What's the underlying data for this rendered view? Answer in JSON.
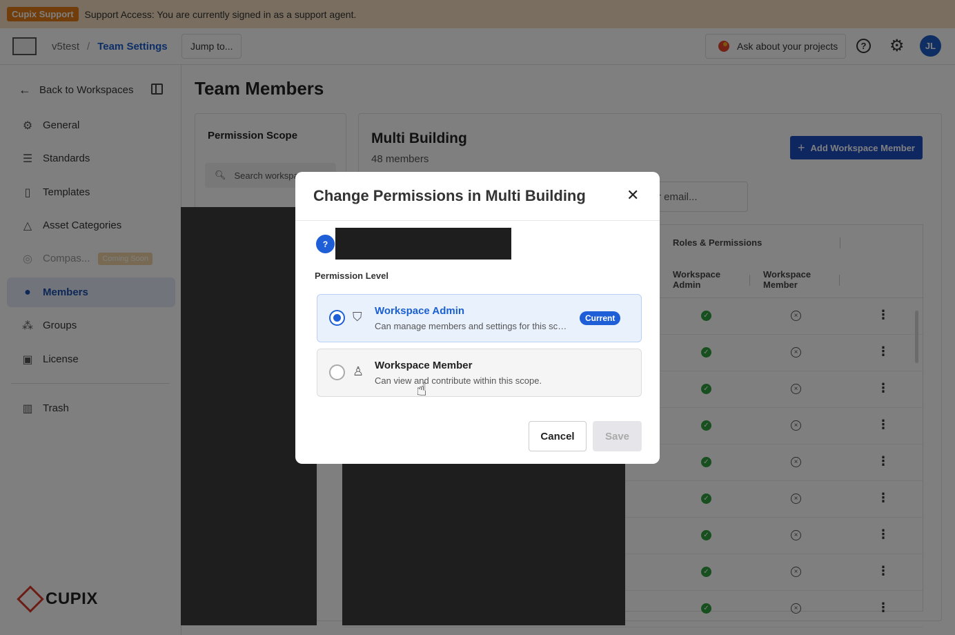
{
  "banner": {
    "badge": "Cupix Support",
    "message": "Support Access: You are currently signed in as a support agent."
  },
  "topbar": {
    "workspace": "v5test",
    "separator": "/",
    "current": "Team Settings",
    "jump_label": "Jump to...",
    "ask_label": "Ask about your projects",
    "help_glyph": "?",
    "avatar_initials": "JL"
  },
  "sidebar": {
    "back_label": "Back to Workspaces",
    "items": [
      {
        "label": "General",
        "icon": "gear-icon"
      },
      {
        "label": "Standards",
        "icon": "sliders-icon"
      },
      {
        "label": "Templates",
        "icon": "document-icon"
      },
      {
        "label": "Asset Categories",
        "icon": "shapes-icon"
      },
      {
        "label": "Compas...",
        "icon": "compass-icon",
        "badge": "Coming Soon"
      },
      {
        "label": "Members",
        "icon": "person-icon",
        "active": true
      },
      {
        "label": "Groups",
        "icon": "group-icon"
      },
      {
        "label": "License",
        "icon": "license-icon"
      },
      {
        "label": "Trash",
        "icon": "trash-icon"
      }
    ],
    "brand": "CUPIX"
  },
  "main": {
    "title": "Team Members",
    "scope": {
      "title": "Permission Scope",
      "search_placeholder": "Search workspa"
    },
    "members": {
      "title": "Multi Building",
      "count": "48 members",
      "add_label": "Add Workspace Member",
      "email_placeholder": "r email...",
      "col_roles": "Roles & Permissions",
      "col_admin": "Workspace Admin",
      "col_member": "Workspace Member",
      "row_count": 9
    }
  },
  "modal": {
    "title": "Change Permissions in Multi Building",
    "close_glyph": "✕",
    "user_glyph": "?",
    "permission_label": "Permission Level",
    "options": [
      {
        "name": "Workspace Admin",
        "description": "Can manage members and settings for this scope.",
        "badge": "Current",
        "selected": true
      },
      {
        "name": "Workspace Member",
        "description": "Can view and contribute within this scope.",
        "selected": false
      }
    ],
    "cancel_label": "Cancel",
    "save_label": "Save"
  },
  "colors": {
    "accent": "#1e5fd8",
    "banner_bg": "#f3ddbf",
    "support_badge": "#e07b16",
    "success": "#2e9e3f"
  }
}
